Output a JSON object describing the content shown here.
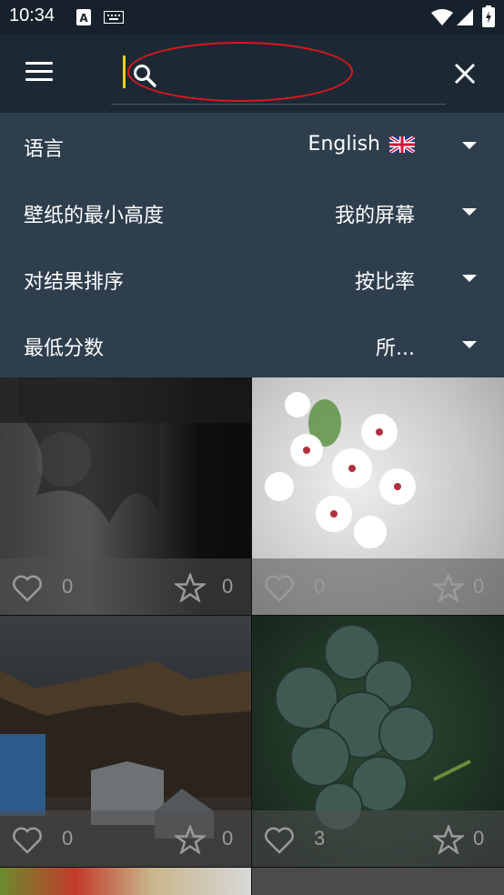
{
  "status_bar": {
    "time": "10:34"
  },
  "search": {
    "value": "",
    "placeholder": ""
  },
  "filters": [
    {
      "label": "语言",
      "value": "English"
    },
    {
      "label": "壁纸的最小高度",
      "value": "我的屏幕"
    },
    {
      "label": "对结果排序",
      "value": "按比率"
    },
    {
      "label": "最低分数",
      "value": "所..."
    }
  ],
  "tiles": [
    {
      "likes": "0",
      "favorites": "0"
    },
    {
      "likes": "0",
      "favorites": "0"
    },
    {
      "likes": "0",
      "favorites": "0"
    },
    {
      "likes": "3",
      "favorites": "0"
    }
  ],
  "colors": {
    "accent_cursor": "#f2cf1d",
    "annotation": "#e0161b",
    "toolbar": "#1c2935",
    "filter_panel": "#2e3e4d"
  }
}
